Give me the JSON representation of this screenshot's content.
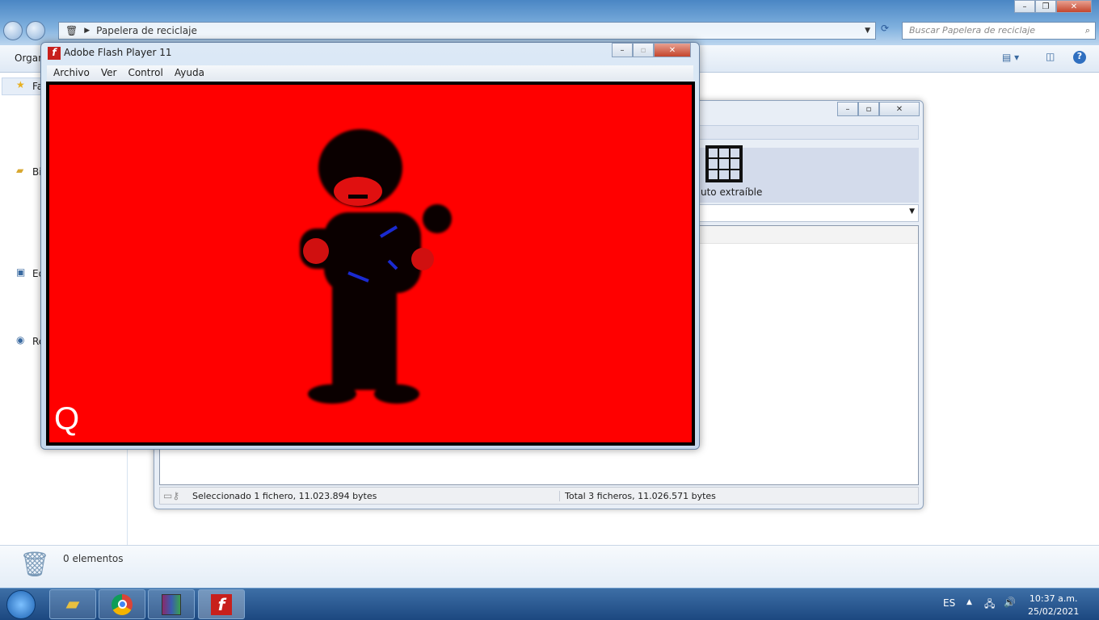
{
  "explorer": {
    "address": "Papelera de reciclaje",
    "search_placeholder": "Buscar Papelera de reciclaje",
    "organize": "Organ",
    "nav_items": [
      "Fa",
      "Bi",
      "Ed",
      "Re"
    ],
    "details_count": "0 elementos"
  },
  "rar": {
    "toolbar_label": "uto extraíble",
    "status_selected": "Seleccionado 1 fichero, 11.023.894 bytes",
    "status_total": "Total 3 ficheros, 11.026.571 bytes"
  },
  "flash": {
    "title": "Adobe Flash Player 11",
    "menu": [
      "Archivo",
      "Ver",
      "Control",
      "Ayuda"
    ],
    "stage_color": "#ff0000",
    "stage_letter": "Q"
  },
  "taskbar": {
    "lang": "ES",
    "time": "10:37 a.m.",
    "date": "25/02/2021"
  }
}
